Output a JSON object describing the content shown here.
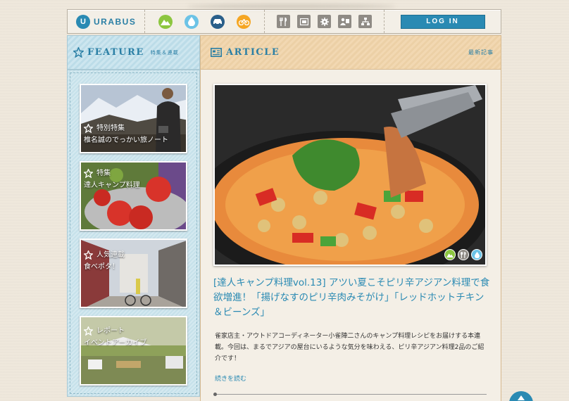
{
  "brand": {
    "logo_letter": "U",
    "name": "URABUS"
  },
  "nav": {
    "category_icons": [
      "mountain-icon",
      "water-drop-icon",
      "car-icon",
      "bicycle-icon"
    ],
    "category_colors": [
      "#8cc63f",
      "#6cc3e6",
      "#2a5f8a",
      "#f5a623"
    ],
    "utility_icons": [
      "restaurant-icon",
      "screen-icon",
      "gear-icon",
      "people-icon",
      "sitemap-icon"
    ],
    "login_label": "LOG IN"
  },
  "feature": {
    "title": "FEATURE",
    "subtitle": "特集＆連載",
    "cards": [
      {
        "tag": "特別特集",
        "text": "椎名誠のでっかい旅ノート"
      },
      {
        "tag": "特集",
        "text": "達人キャンプ料理"
      },
      {
        "tag": "人気連載",
        "text": "食べポタ！"
      },
      {
        "tag": "レポート",
        "text": "イベントアーカイブ"
      }
    ]
  },
  "article": {
    "title": "ARTICLE",
    "subtitle": "最新記事",
    "headline": "[達人キャンプ料理vol.13] アツい夏こそピリ辛アジアン料理で食欲増進！「揚げなすのピリ辛肉みそがけ」「レッドホットチキン＆ビーンズ」",
    "body": "雀家店主・アウトドアコーディネーター小雀陣二さんのキャンプ料理レシピをお届けする本連載。今回は、まるでアジアの屋台にいるような気分を味わえる、ピリ辛アジアン料理2品のご紹介です！",
    "more_label": "続きを読む",
    "tag_icons": [
      "mountain-icon",
      "restaurant-icon",
      "water-drop-icon"
    ]
  },
  "colors": {
    "accent": "#2a8ab3",
    "feature_bg": "#cde6ef",
    "article_bg": "#f2d8b2"
  }
}
